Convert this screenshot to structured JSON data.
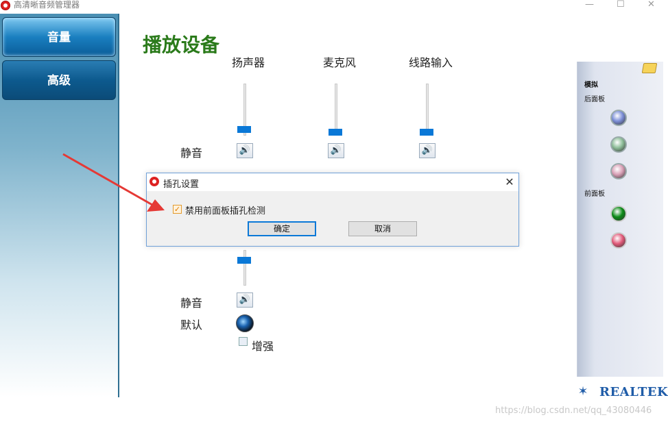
{
  "window": {
    "title": "高清晰音频管理器",
    "minimize": "—",
    "maximize": "☐",
    "close": "✕"
  },
  "sidebar": {
    "items": [
      {
        "label": "音量",
        "active": true
      },
      {
        "label": "高级",
        "active": false
      }
    ]
  },
  "main": {
    "title": "播放设备",
    "columns": [
      {
        "label": "扬声器",
        "level": 0.1
      },
      {
        "label": "麦克风",
        "level": 0.1
      },
      {
        "label": "线路输入",
        "level": 0.1
      }
    ],
    "mute_label": "静音",
    "speaker_icon": "speaker-icon",
    "mute_label2": "静音",
    "default_label": "默认",
    "enhance_label": "增强"
  },
  "dialog": {
    "title": "插孔设置",
    "close": "✕",
    "checkbox_label": "禁用前面板插孔检测",
    "checkbox_checked": true,
    "ok": "确定",
    "cancel": "取消"
  },
  "right_panel": {
    "section": "模拟",
    "back_panel": "后面板",
    "front_panel": "前面板",
    "jacks_back": [
      {
        "name": "blue-jack-icon",
        "color": "#7c8fd8"
      },
      {
        "name": "green-jack-icon",
        "color": "#8dbd98"
      },
      {
        "name": "pink-jack-icon",
        "color": "#d9a0b6"
      }
    ],
    "jacks_front": [
      {
        "name": "green-jack-icon",
        "color": "#0a8a16"
      },
      {
        "name": "pink-jack-icon",
        "color": "#e25a7a"
      }
    ]
  },
  "branding": {
    "realtek": "REALTEK"
  },
  "watermark": "https://blog.csdn.net/qq_43080446",
  "annotation": {
    "arrow_color": "#e53935"
  }
}
